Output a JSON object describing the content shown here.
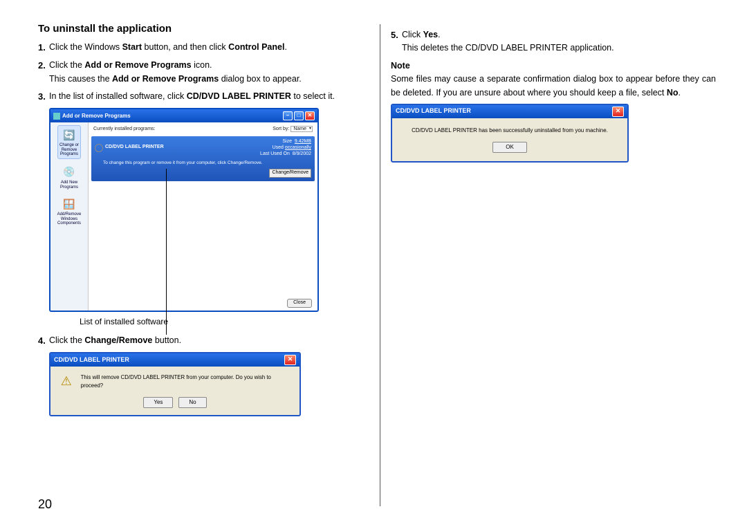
{
  "page_number": "20",
  "left": {
    "title": "To uninstall the application",
    "step1": {
      "num": "1.",
      "a": "Click the Windows ",
      "b": "Start",
      "c": " button, and then click ",
      "d": "Control Panel",
      "e": "."
    },
    "step2": {
      "num": "2.",
      "a": "Click the ",
      "b": "Add or Remove Programs",
      "c": " icon.",
      "sub_a": "This causes the ",
      "sub_b": "Add or Remove Programs",
      "sub_c": " dialog box to appear."
    },
    "step3": {
      "num": "3.",
      "a": "In the list of installed software, click ",
      "b": "CD/DVD LABEL PRINTER",
      "c": " to select it."
    },
    "arp": {
      "title": "Add or Remove Programs",
      "side1": "Change or\nRemove\nPrograms",
      "side2": "Add New\nPrograms",
      "side3": "Add/Remove\nWindows\nComponents",
      "currently": "Currently installed programs:",
      "sortby": "Sort by:",
      "sortval": "Name",
      "selname": "CD/DVD LABEL PRINTER",
      "size_label": "Size",
      "size_val": "9.42MB",
      "used_label": "Used",
      "used_val": "occasionally",
      "last_label": "Last Used On",
      "last_val": "8/9/2002",
      "desc": "To change this program or remove it from your computer, click Change/Remove.",
      "change": "Change/Remove",
      "close": "Close"
    },
    "caption": "List of installed software",
    "step4": {
      "num": "4.",
      "a": "Click the ",
      "b": "Change/Remove",
      "c": " button."
    },
    "msg1": {
      "title": "CD/DVD LABEL PRINTER",
      "text": "This will remove CD/DVD LABEL PRINTER from your computer. Do you wish to proceed?",
      "yes": "Yes",
      "no": "No"
    }
  },
  "right": {
    "step5": {
      "num": "5.",
      "a": "Click ",
      "b": "Yes",
      "c": ".",
      "sub": "This deletes the CD/DVD LABEL PRINTER application."
    },
    "note_title": "Note",
    "note_a": "Some files may cause a separate confirmation dialog box to appear before they can be deleted. If you are unsure about where you should keep a file, select ",
    "note_b": "No",
    "note_c": ".",
    "msg2": {
      "title": "CD/DVD LABEL PRINTER",
      "text": "CD/DVD LABEL PRINTER has been successfully uninstalled from you machine.",
      "ok": "OK"
    }
  }
}
